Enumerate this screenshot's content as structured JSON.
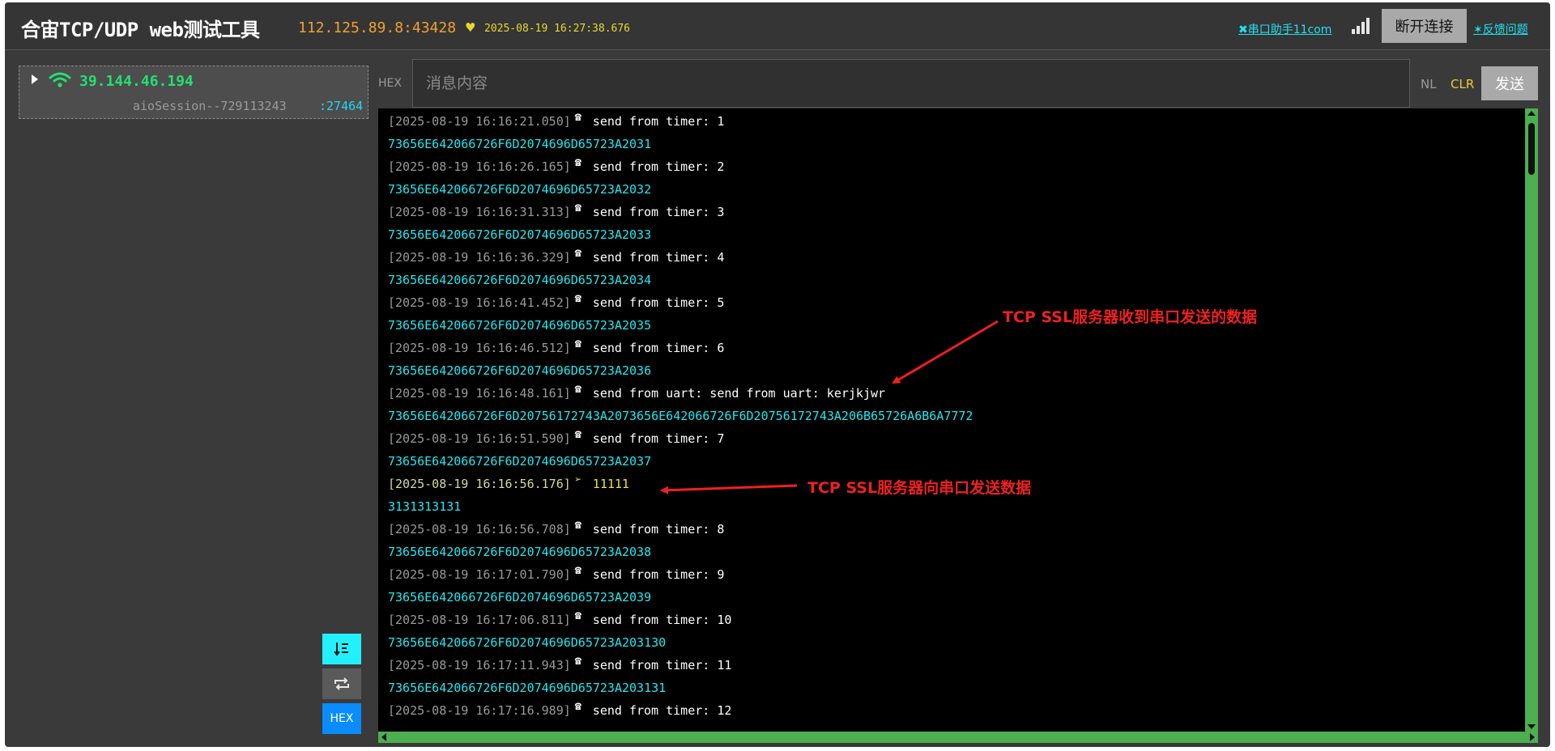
{
  "header": {
    "title": "合宙TCP/UDP web测试工具",
    "server_addr": "112.125.89.8:43428",
    "server_time": "2025-08-19 16:27:38.676",
    "uart_link": "串口助手11com",
    "disconnect_label": "断开连接",
    "feedback_link": "反馈问题"
  },
  "session": {
    "ip": "39.144.46.194",
    "name": "aioSession--729113243",
    "port": ":27464"
  },
  "sidebar_buttons": {
    "hex_label": "HEX"
  },
  "send_bar": {
    "hex_toggle": "HEX",
    "placeholder": "消息内容",
    "nl_toggle": "NL",
    "clr_label": "CLR",
    "send_label": "发送"
  },
  "log": [
    {
      "ts": "[2025-08-19 16:16:21.050]",
      "dir": "recv",
      "msg": "send from timer: 1",
      "hex": "73656E642066726F6D2074696D65723A2031"
    },
    {
      "ts": "[2025-08-19 16:16:26.165]",
      "dir": "recv",
      "msg": "send from timer: 2",
      "hex": "73656E642066726F6D2074696D65723A2032"
    },
    {
      "ts": "[2025-08-19 16:16:31.313]",
      "dir": "recv",
      "msg": "send from timer: 3",
      "hex": "73656E642066726F6D2074696D65723A2033"
    },
    {
      "ts": "[2025-08-19 16:16:36.329]",
      "dir": "recv",
      "msg": "send from timer: 4",
      "hex": "73656E642066726F6D2074696D65723A2034"
    },
    {
      "ts": "[2025-08-19 16:16:41.452]",
      "dir": "recv",
      "msg": "send from timer: 5",
      "hex": "73656E642066726F6D2074696D65723A2035"
    },
    {
      "ts": "[2025-08-19 16:16:46.512]",
      "dir": "recv",
      "msg": "send from timer: 6",
      "hex": "73656E642066726F6D2074696D65723A2036"
    },
    {
      "ts": "[2025-08-19 16:16:48.161]",
      "dir": "recv",
      "msg": "send from uart: send from uart: kerjkjwr",
      "hex": "73656E642066726F6D20756172743A2073656E642066726F6D20756172743A206B65726A6B6A7772"
    },
    {
      "ts": "[2025-08-19 16:16:51.590]",
      "dir": "recv",
      "msg": "send from timer: 7",
      "hex": "73656E642066726F6D2074696D65723A2037"
    },
    {
      "ts": "[2025-08-19 16:16:56.176]",
      "dir": "send",
      "msg": "11111",
      "hex": "3131313131"
    },
    {
      "ts": "[2025-08-19 16:16:56.708]",
      "dir": "recv",
      "msg": "send from timer: 8",
      "hex": "73656E642066726F6D2074696D65723A2038"
    },
    {
      "ts": "[2025-08-19 16:17:01.790]",
      "dir": "recv",
      "msg": "send from timer: 9",
      "hex": "73656E642066726F6D2074696D65723A2039"
    },
    {
      "ts": "[2025-08-19 16:17:06.811]",
      "dir": "recv",
      "msg": "send from timer: 10",
      "hex": "73656E642066726F6D2074696D65723A203130"
    },
    {
      "ts": "[2025-08-19 16:17:11.943]",
      "dir": "recv",
      "msg": "send from timer: 11",
      "hex": "73656E642066726F6D2074696D65723A203131"
    },
    {
      "ts": "[2025-08-19 16:17:16.989]",
      "dir": "recv",
      "msg": "send from timer: 12",
      "hex": ""
    }
  ],
  "annotations": {
    "recv_note": "TCP SSL服务器收到串口发送的数据",
    "send_note": "TCP SSL服务器向串口发送数据"
  },
  "colors": {
    "accent_cyan": "#22e8f0",
    "accent_green": "#4caf50",
    "annotation_red": "#f02020",
    "sent_yellow": "#f0e040"
  }
}
